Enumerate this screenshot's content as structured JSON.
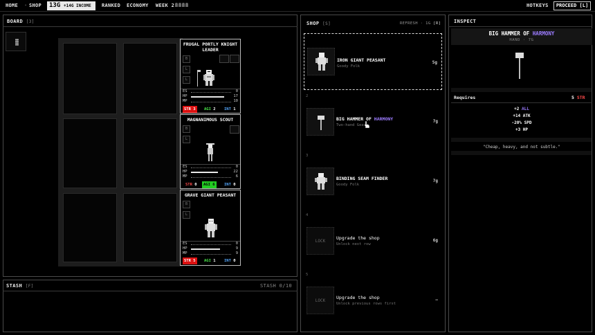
{
  "topbar": {
    "home": "HOME",
    "sep": "·",
    "shop": "SHOP",
    "gold": "13G",
    "income": "+14G INCOME",
    "ranked": "RANKED",
    "economy": "ECONOMY",
    "week": "WEEK 2",
    "hotkeys": "HOTKEYS",
    "proceed": "PROCEED [L]"
  },
  "board": {
    "title": "BOARD",
    "count": "[3]",
    "units": [
      {
        "name": "FRUGAL PORTLY KNIGHT LEADER",
        "slots": [
          "B",
          "L",
          "L"
        ],
        "es_label": "ES",
        "es": "0",
        "hp_label": "HP",
        "hp": "17",
        "hp_fill": 0.85,
        "mp_label": "MP",
        "mp": "10",
        "attrs": [
          {
            "label": "STR",
            "value": "3",
            "on": true
          },
          {
            "label": "AGI",
            "value": "2",
            "on": false
          },
          {
            "label": "INT",
            "value": "1",
            "on": false
          }
        ]
      },
      {
        "name": "MAGNANIMOUS SCOUT",
        "slots": [
          "B",
          "L"
        ],
        "es_label": "ES",
        "es": "0",
        "hp_label": "HP",
        "hp": "22",
        "hp_fill": 0.7,
        "mp_label": "MP",
        "mp": "6",
        "attrs": [
          {
            "label": "STR",
            "value": "0",
            "on": false
          },
          {
            "label": "AGI",
            "value": "6",
            "on": true
          },
          {
            "label": "INT",
            "value": "0",
            "on": false
          }
        ]
      },
      {
        "name": "GRAVE GIANT PEASANT",
        "slots": [
          "B",
          "L"
        ],
        "es_label": "ES",
        "es": "0",
        "hp_label": "HP",
        "hp": "9",
        "hp_fill": 0.75,
        "mp_label": "MP",
        "mp": "9",
        "attrs": [
          {
            "label": "STR",
            "value": "5",
            "on": true
          },
          {
            "label": "AGI",
            "value": "1",
            "on": false
          },
          {
            "label": "INT",
            "value": "0",
            "on": false
          }
        ]
      }
    ]
  },
  "stash": {
    "title": "STASH",
    "count": "[F]",
    "capacity": "STASH 0/10"
  },
  "shop": {
    "title": "SHOP",
    "count": "[S]",
    "refresh": "REFRESH · 1G",
    "refresh_key": "[R]",
    "rows": [
      {
        "num": "1",
        "name": "IRON GIANT PEASANT",
        "sub": "Goody Folk",
        "price": "5g"
      },
      {
        "num": "2",
        "name_a": "BIG HAMMER OF ",
        "name_b": "HARMONY",
        "sub": "Two-hand Gear",
        "price": "7g"
      },
      {
        "num": "3",
        "name": "BINDING SEAM FINDER",
        "sub": "Goody Folk",
        "price": "7g"
      },
      {
        "num": "4",
        "lock": "LOCK",
        "name": "Upgrade the shop",
        "sub": "Unlock next row",
        "price": "6g"
      },
      {
        "num": "5",
        "lock": "LOCK",
        "name": "Upgrade the shop",
        "sub": "Unlock previous rows first",
        "price": "—"
      }
    ]
  },
  "inspect": {
    "title": "INSPECT",
    "name_a": "BIG HAMMER OF ",
    "name_b": "HARMONY",
    "sub": "HAND · 7G",
    "requires_label": "Requires",
    "requires_value": "5",
    "requires_attr": "STR",
    "effects": [
      {
        "prefix": "+2 ",
        "text": "ALL",
        "accent": true
      },
      {
        "prefix": "+14 ",
        "text": "ATK",
        "accent": false
      },
      {
        "prefix": "-20% ",
        "text": "SPD",
        "accent": false
      },
      {
        "prefix": "+3 ",
        "text": "HP",
        "accent": false
      }
    ],
    "quote": "\"Cheap, heavy, and not subtle.\""
  },
  "colors": {
    "str": "#ff4a4a",
    "agi": "#49e349",
    "int": "#55a8ff",
    "accent": "#9c7cff"
  }
}
